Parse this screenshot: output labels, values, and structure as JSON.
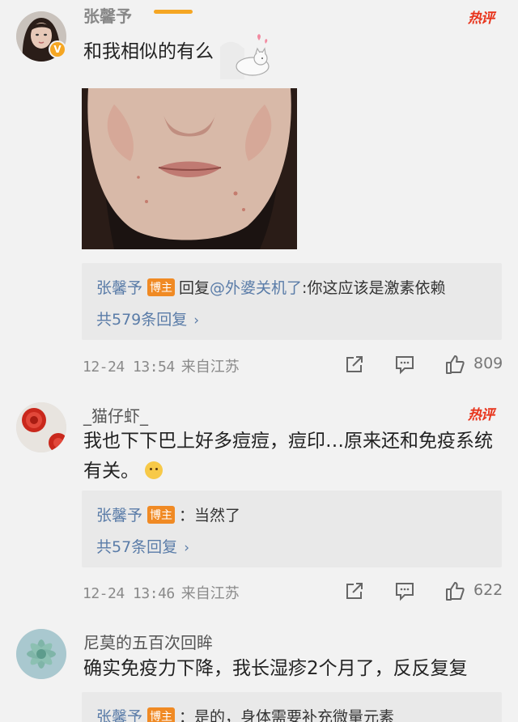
{
  "comments": [
    {
      "username": "张馨予",
      "verified_badge": "V",
      "hot_label": "热评",
      "text": "和我相似的有么",
      "has_photo": true,
      "reply": {
        "author": "张馨予",
        "badge": "博主",
        "prefix": "回复",
        "mention": "@外婆关机了",
        "content": ":你这应该是激素依赖"
      },
      "more_replies": "共579条回复",
      "timestamp": "12-24 13:54",
      "source": "来自江苏",
      "likes": "809"
    },
    {
      "username": "_猫仔虾_",
      "hot_label": "热评",
      "text_line1": "我也下下巴上好多痘痘，痘印…原来还和免疫系统",
      "text_line2": "有关。",
      "emoji": "😶",
      "reply": {
        "author": "张馨予",
        "badge": "博主",
        "content": "：当然了"
      },
      "more_replies": "共57条回复",
      "timestamp": "12-24 13:46",
      "source": "来自江苏",
      "likes": "622"
    },
    {
      "username": "尼莫的五百次回眸",
      "text": "确实免疫力下降，我长湿疹2个月了，反反复复",
      "reply": {
        "author": "张馨予",
        "badge": "博主",
        "content": "：是的，身体需要补充微量元素"
      }
    }
  ],
  "icons": {
    "share": "share-icon",
    "comment": "comment-icon",
    "like": "thumbs-up-icon"
  },
  "colors": {
    "accent_orange": "#f08a24",
    "hot_red": "#e8341c",
    "link_blue": "#5a7ca8"
  }
}
